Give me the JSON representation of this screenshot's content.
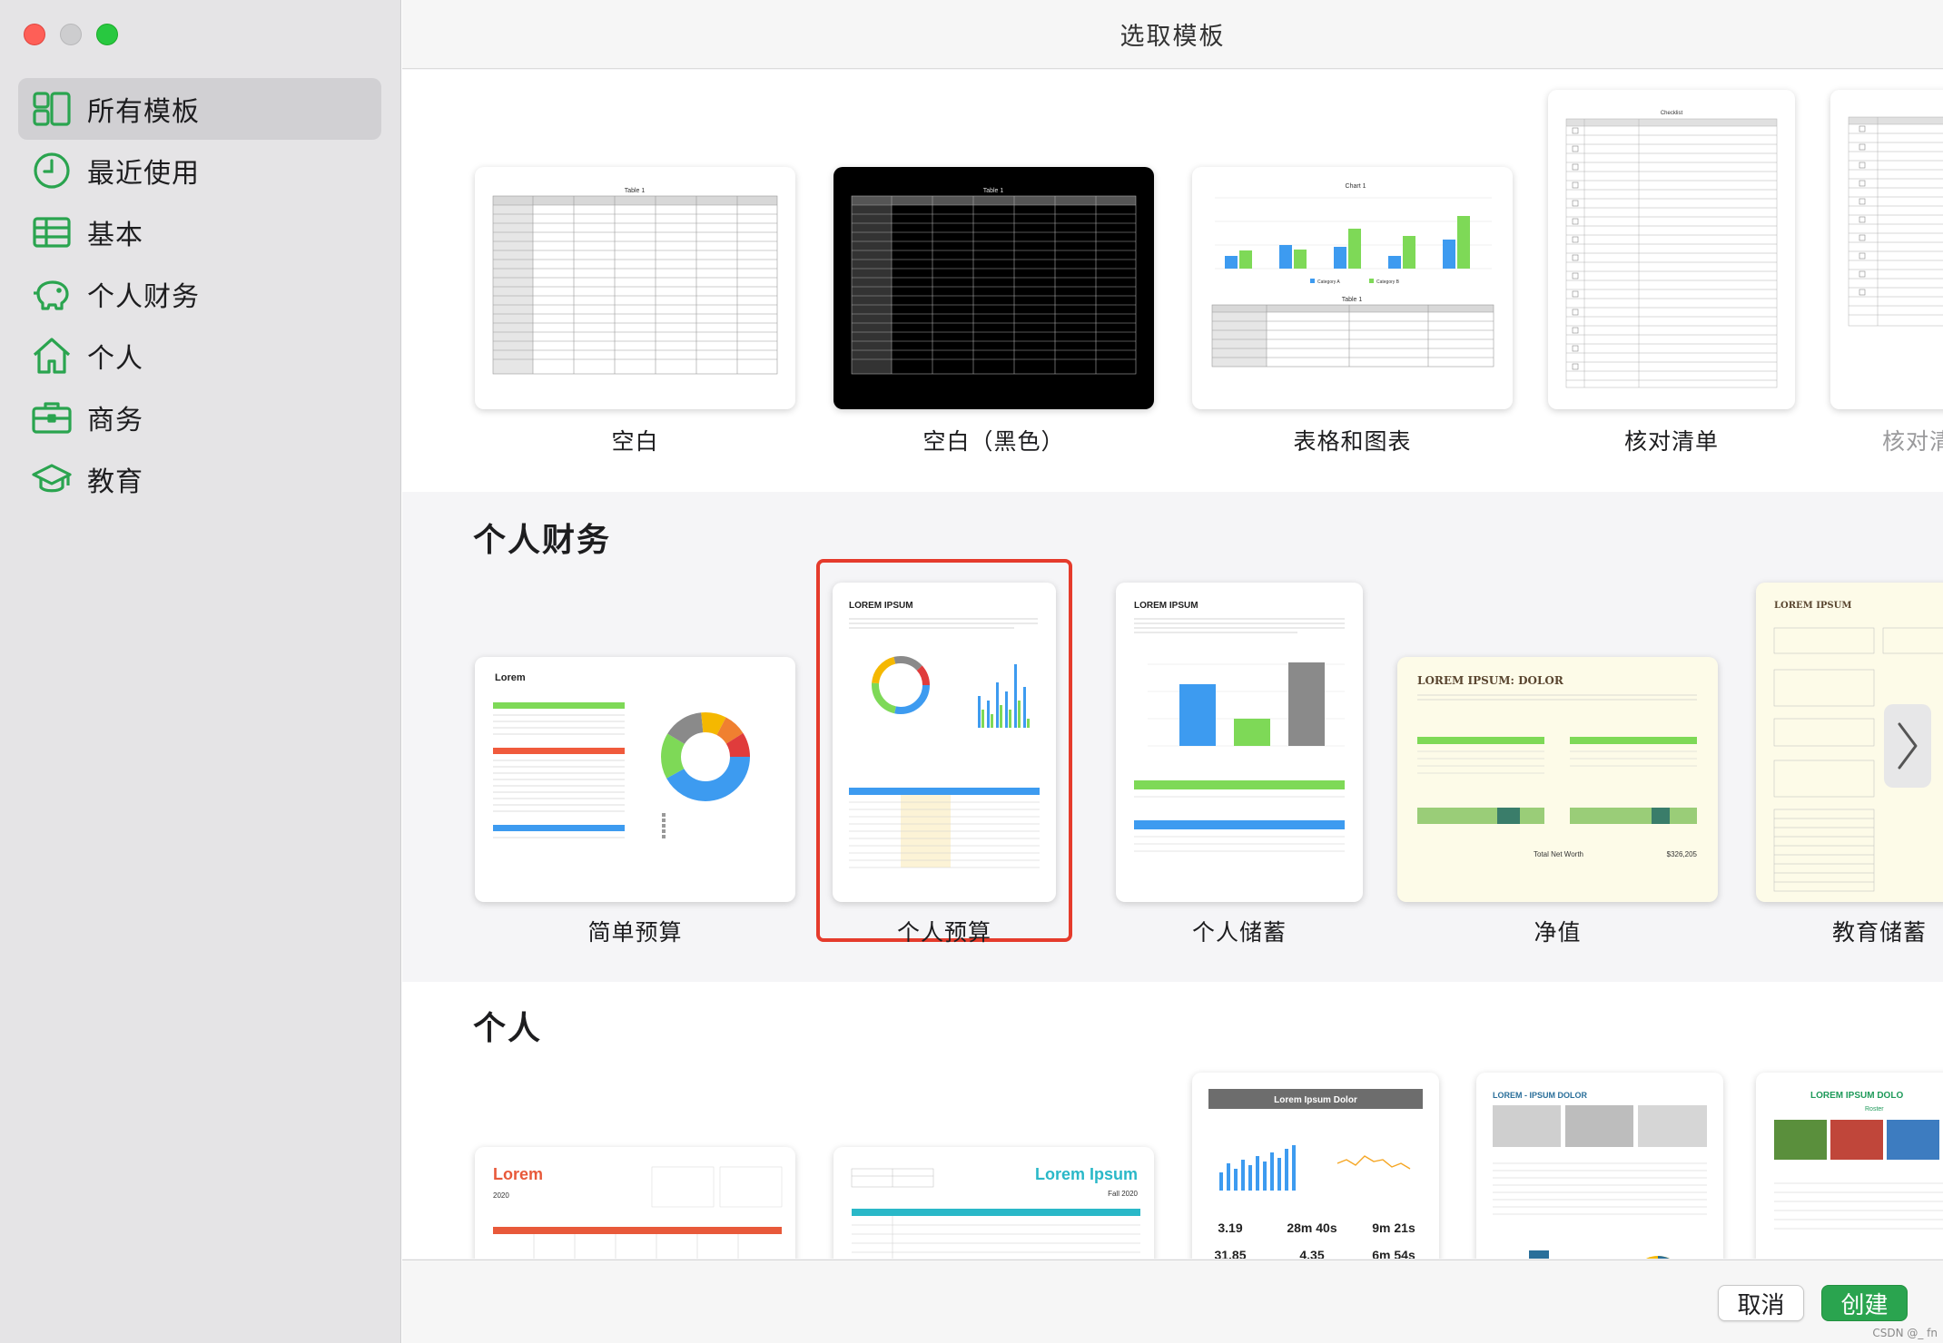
{
  "window": {
    "title": "选取模板"
  },
  "sidebar": {
    "items": [
      {
        "label": "所有模板",
        "icon": "all-templates-icon",
        "active": true
      },
      {
        "label": "最近使用",
        "icon": "clock-icon",
        "active": false
      },
      {
        "label": "基本",
        "icon": "table-icon",
        "active": false
      },
      {
        "label": "个人财务",
        "icon": "piggy-bank-icon",
        "active": false
      },
      {
        "label": "个人",
        "icon": "house-icon",
        "active": false
      },
      {
        "label": "商务",
        "icon": "briefcase-icon",
        "active": false
      },
      {
        "label": "教育",
        "icon": "graduation-cap-icon",
        "active": false
      }
    ]
  },
  "sections": {
    "basic": {
      "templates": [
        {
          "label": "空白",
          "preview_title": "Table 1"
        },
        {
          "label": "空白（黑色）",
          "preview_title": "Table 1"
        },
        {
          "label": "表格和图表",
          "preview_title": "Chart 1",
          "preview_subtitle": "Table 1",
          "legend_a": "Category A",
          "legend_b": "Category B"
        },
        {
          "label": "核对清单",
          "preview_title": "Checklist"
        },
        {
          "label": "核对清"
        }
      ]
    },
    "personal_finance": {
      "title": "个人财务",
      "templates": [
        {
          "label": "简单预算",
          "preview_title": "Lorem"
        },
        {
          "label": "个人预算",
          "preview_title": "LOREM IPSUM",
          "selected": true
        },
        {
          "label": "个人储蓄",
          "preview_title": "LOREM IPSUM"
        },
        {
          "label": "净值",
          "preview_title": "LOREM IPSUM: DOLOR",
          "total_label": "Total Net Worth",
          "total_value": "$326,205"
        },
        {
          "label": "教育储蓄",
          "preview_title": "LOREM IPSUM"
        }
      ]
    },
    "personal": {
      "title": "个人",
      "templates": [
        {
          "preview_title": "Lorem",
          "preview_year": "2020"
        },
        {
          "preview_title": "Lorem Ipsum",
          "preview_subtitle": "Fall 2020"
        },
        {
          "preview_title": "Lorem Ipsum Dolor",
          "stats": [
            "3.19",
            "28m 40s",
            "9m 21s",
            "31.85",
            "4.35",
            "6m 54s"
          ]
        },
        {
          "preview_title": "LOREM - IPSUM DOLOR"
        },
        {
          "preview_title": "LOREM IPSUM DOLO",
          "preview_subtitle": "Roster"
        }
      ]
    }
  },
  "footer": {
    "cancel_label": "取消",
    "create_label": "创建",
    "watermark": "CSDN @_ fn"
  },
  "colors": {
    "accent_green": "#2aa44f",
    "selection_red": "#e53b2c",
    "icon_green": "#2aa44f"
  }
}
